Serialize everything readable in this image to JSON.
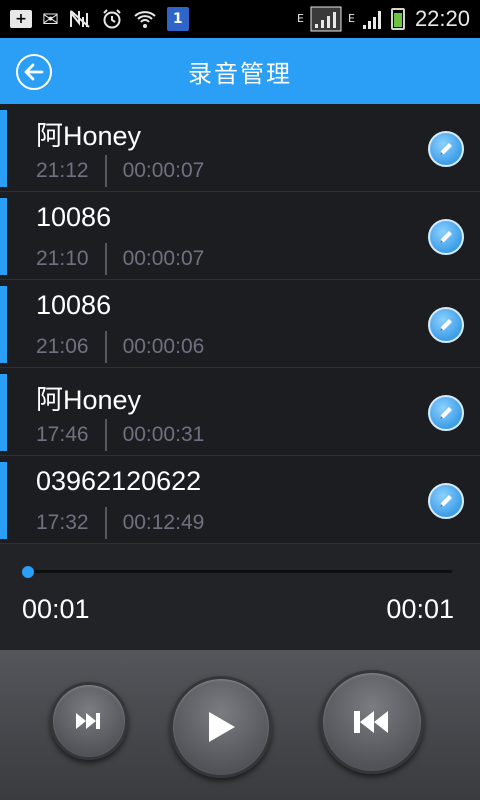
{
  "status_bar": {
    "time": "22:20",
    "sim_badge": "1",
    "network_label_1": "E",
    "network_label_2": "E"
  },
  "header": {
    "title": "录音管理",
    "accent_color": "#2b9ff5"
  },
  "recordings": [
    {
      "name": "阿Honey",
      "time": "21:12",
      "duration": "00:00:07"
    },
    {
      "name": "10086",
      "time": "21:10",
      "duration": "00:00:07"
    },
    {
      "name": "10086",
      "time": "21:06",
      "duration": "00:00:06"
    },
    {
      "name": "阿Honey",
      "time": "17:46",
      "duration": "00:00:31"
    },
    {
      "name": "03962120622",
      "time": "17:32",
      "duration": "00:12:49"
    }
  ],
  "player": {
    "current_time": "00:01",
    "total_time": "00:01",
    "progress": 0.0
  },
  "controls": {
    "next_icon": "skip-forward-icon",
    "play_icon": "play-icon",
    "prev_icon": "skip-back-icon"
  }
}
